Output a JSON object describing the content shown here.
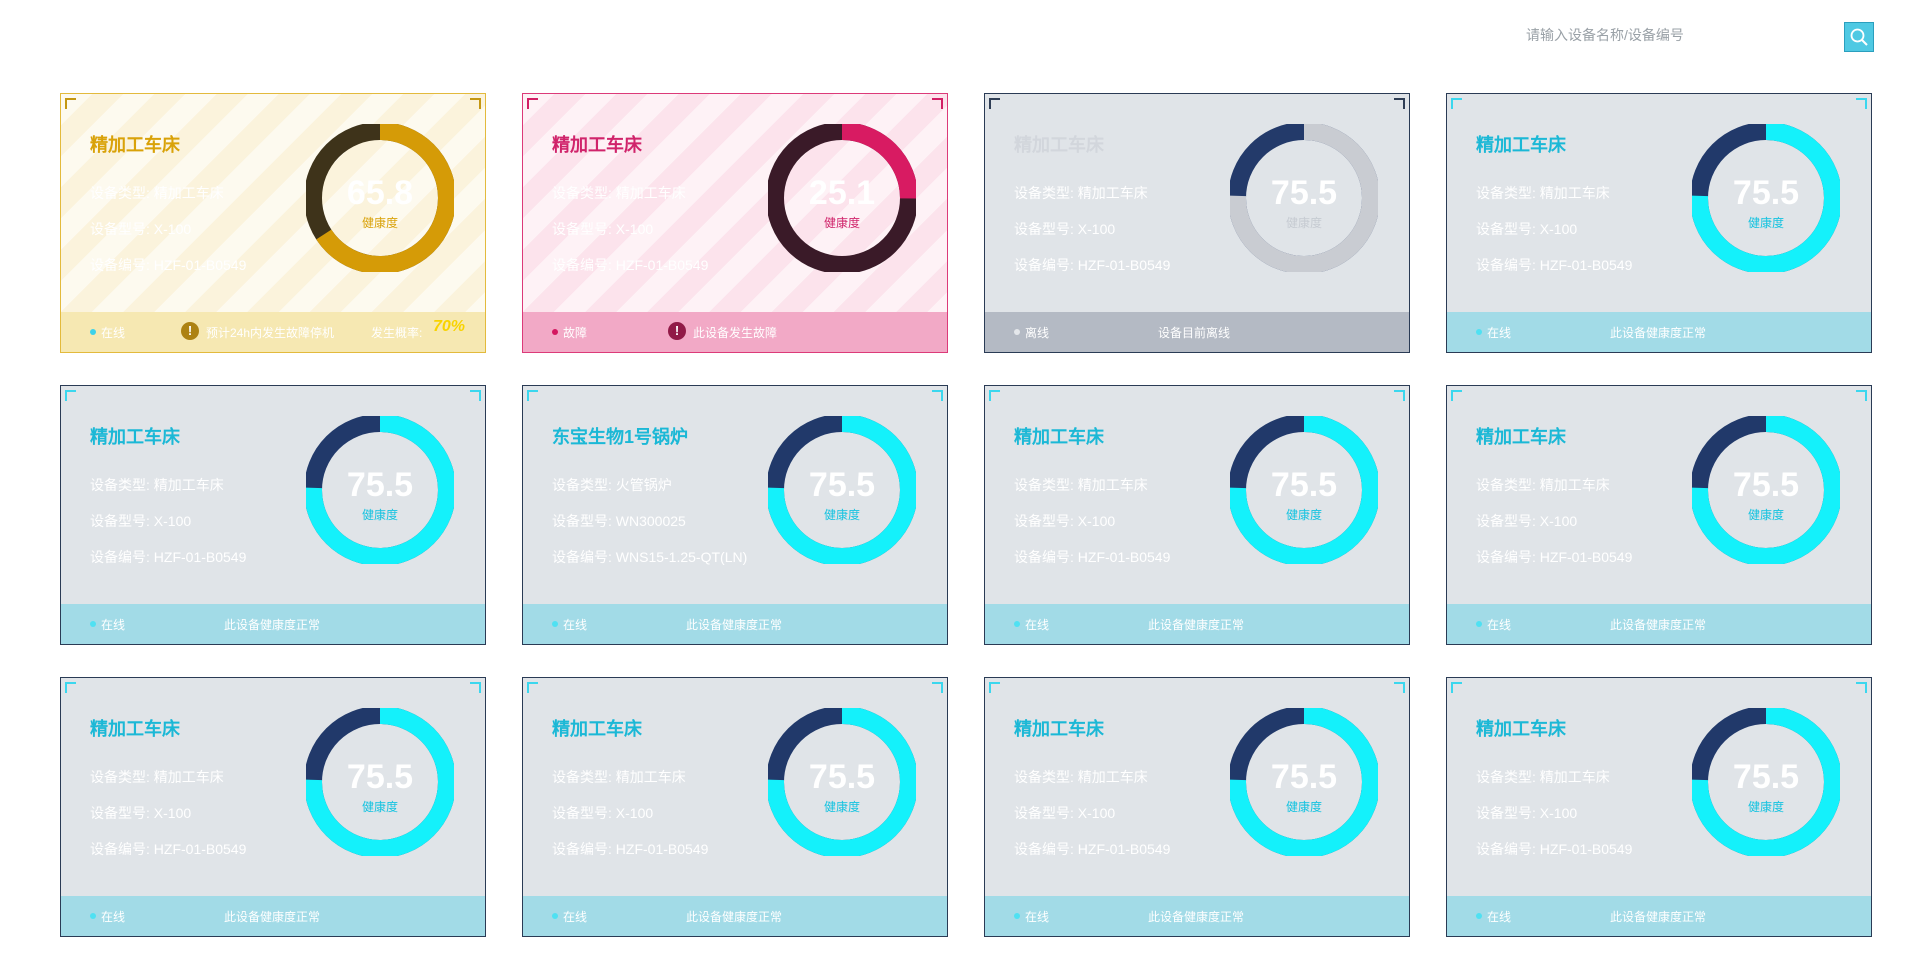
{
  "search": {
    "placeholder": "请输入设备名称/设备编号"
  },
  "colors": {
    "normal_fill": "#14f1fb",
    "normal_dark": "#21396a",
    "warning_fill": "#d59b07",
    "warning_dark": "#3e331a",
    "fault_fill": "#d81b62",
    "fault_dark": "#3a1a28",
    "offline_fill": "#c9ccd2",
    "offline_dark": "#233a6a"
  },
  "labels": {
    "type": "设备类型:",
    "model": "设备型号:",
    "serial": "设备编号:",
    "health": "健康度",
    "probability": "发生概率:"
  },
  "devices": [
    {
      "status": "warning",
      "name": "精加工车床",
      "type": "精加工车床",
      "model": "X-100",
      "serial": "HZF-01-B0549",
      "health": 65.8,
      "health_text": "65.8",
      "status_text": "在线",
      "message": "预计24h内发生故障停机",
      "probability": "70%"
    },
    {
      "status": "fault",
      "name": "精加工车床",
      "type": "精加工车床",
      "model": "X-100",
      "serial": "HZF-01-B0549",
      "health": 25.1,
      "health_text": "25.1",
      "status_text": "故障",
      "message": "此设备发生故障"
    },
    {
      "status": "offline",
      "name": "精加工车床",
      "type": "精加工车床",
      "model": "X-100",
      "serial": "HZF-01-B0549",
      "health": 75.5,
      "health_text": "75.5",
      "status_text": "离线",
      "message": "设备目前离线"
    },
    {
      "status": "normal",
      "name": "精加工车床",
      "type": "精加工车床",
      "model": "X-100",
      "serial": "HZF-01-B0549",
      "health": 75.5,
      "health_text": "75.5",
      "status_text": "在线",
      "message": "此设备健康度正常"
    },
    {
      "status": "normal",
      "name": "精加工车床",
      "type": "精加工车床",
      "model": "X-100",
      "serial": "HZF-01-B0549",
      "health": 75.5,
      "health_text": "75.5",
      "status_text": "在线",
      "message": "此设备健康度正常"
    },
    {
      "status": "normal",
      "name": "东宝生物1号锅炉",
      "type": "火管锅炉",
      "model": "WN300025",
      "serial": "WNS15-1.25-QT(LN)",
      "health": 75.5,
      "health_text": "75.5",
      "status_text": "在线",
      "message": "此设备健康度正常"
    },
    {
      "status": "normal",
      "name": "精加工车床",
      "type": "精加工车床",
      "model": "X-100",
      "serial": "HZF-01-B0549",
      "health": 75.5,
      "health_text": "75.5",
      "status_text": "在线",
      "message": "此设备健康度正常"
    },
    {
      "status": "normal",
      "name": "精加工车床",
      "type": "精加工车床",
      "model": "X-100",
      "serial": "HZF-01-B0549",
      "health": 75.5,
      "health_text": "75.5",
      "status_text": "在线",
      "message": "此设备健康度正常"
    },
    {
      "status": "normal",
      "name": "精加工车床",
      "type": "精加工车床",
      "model": "X-100",
      "serial": "HZF-01-B0549",
      "health": 75.5,
      "health_text": "75.5",
      "status_text": "在线",
      "message": "此设备健康度正常"
    },
    {
      "status": "normal",
      "name": "精加工车床",
      "type": "精加工车床",
      "model": "X-100",
      "serial": "HZF-01-B0549",
      "health": 75.5,
      "health_text": "75.5",
      "status_text": "在线",
      "message": "此设备健康度正常"
    },
    {
      "status": "normal",
      "name": "精加工车床",
      "type": "精加工车床",
      "model": "X-100",
      "serial": "HZF-01-B0549",
      "health": 75.5,
      "health_text": "75.5",
      "status_text": "在线",
      "message": "此设备健康度正常"
    },
    {
      "status": "normal",
      "name": "精加工车床",
      "type": "精加工车床",
      "model": "X-100",
      "serial": "HZF-01-B0549",
      "health": 75.5,
      "health_text": "75.5",
      "status_text": "在线",
      "message": "此设备健康度正常"
    }
  ]
}
